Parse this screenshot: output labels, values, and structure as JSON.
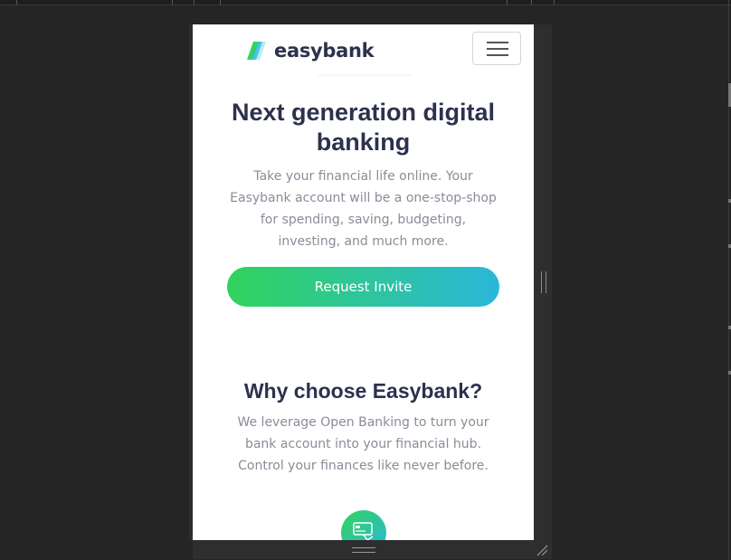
{
  "colors": {
    "devtools_bg": "#252526",
    "heading": "#2d314d",
    "body_text": "#8a8c98",
    "gradient_start": "#31d35c",
    "gradient_end": "#2bb7da"
  },
  "header": {
    "logo_text": "easybank",
    "menu_icon": "hamburger-icon"
  },
  "hero": {
    "title_line1": "Next generation digital",
    "title_line2": "banking",
    "description": "Take your financial life online. Your Easybank account will be a one-stop-shop for spending, saving, budgeting, investing, and much more.",
    "cta_label": "Request Invite"
  },
  "why": {
    "title": "Why choose Easybank?",
    "description": "We leverage Open Banking to turn your bank account into your financial hub. Control your finances like never before.",
    "feature_icon": "online-banking-icon"
  }
}
